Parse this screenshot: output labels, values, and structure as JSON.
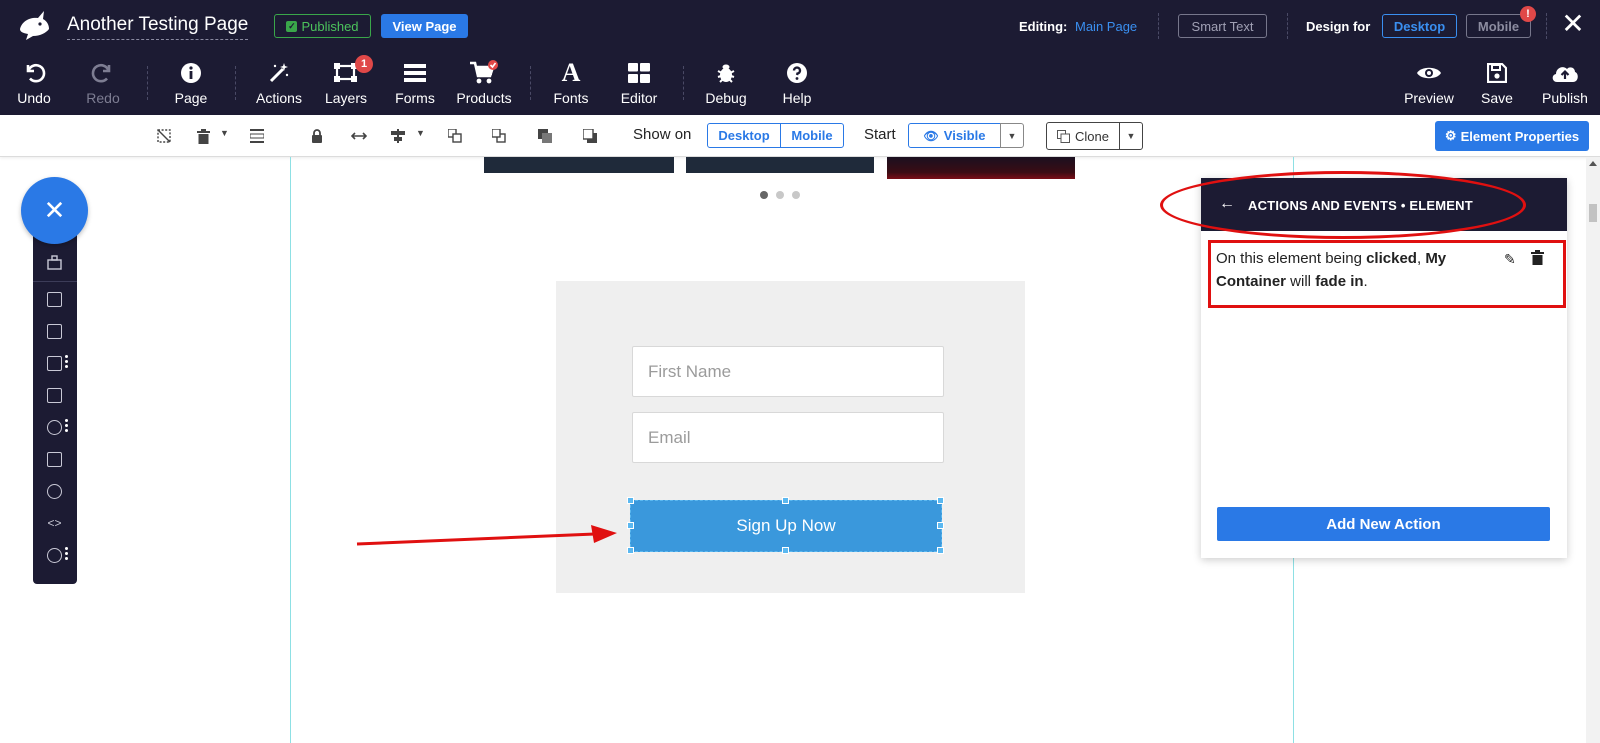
{
  "header": {
    "page_title": "Another Testing Page",
    "published_label": "Published",
    "view_page_label": "View Page",
    "editing_label": "Editing:",
    "editing_value": "Main Page",
    "smart_text_label": "Smart Text",
    "design_for_label": "Design for",
    "desktop_label": "Desktop",
    "mobile_label": "Mobile",
    "mobile_alert": "!",
    "close_icon": "close-icon"
  },
  "toolbar": {
    "undo": "Undo",
    "redo": "Redo",
    "page": "Page",
    "actions": "Actions",
    "layers": "Layers",
    "layers_count": "1",
    "forms": "Forms",
    "products": "Products",
    "fonts": "Fonts",
    "editor": "Editor",
    "debug": "Debug",
    "help": "Help",
    "preview": "Preview",
    "save": "Save",
    "publish": "Publish"
  },
  "element_bar": {
    "show_on_label": "Show on",
    "show_desktop": "Desktop",
    "show_mobile": "Mobile",
    "start_label": "Start",
    "visible_label": "Visible",
    "clone_label": "Clone",
    "element_properties_label": "Element Properties"
  },
  "carousel": {
    "slide_count": 3,
    "active_index": 0
  },
  "form": {
    "first_name_placeholder": "First Name",
    "email_placeholder": "Email",
    "submit_label": "Sign Up Now"
  },
  "panel": {
    "back_icon": "arrow-left-icon",
    "title": "ACTIONS AND EVENTS • ELEMENT",
    "action_prefix": "On this element being ",
    "action_event": "clicked",
    "action_sep": ", ",
    "action_target": "My Container",
    "action_mid": " will ",
    "action_effect": "fade in",
    "action_end": ".",
    "add_action_label": "Add New Action"
  },
  "colors": {
    "header_bg": "#1c1b33",
    "accent": "#2a79e6",
    "published_green": "#3aa64a",
    "alert_red": "#e04848",
    "button_blue": "#3a98dc",
    "annotation_red": "#e01010"
  }
}
